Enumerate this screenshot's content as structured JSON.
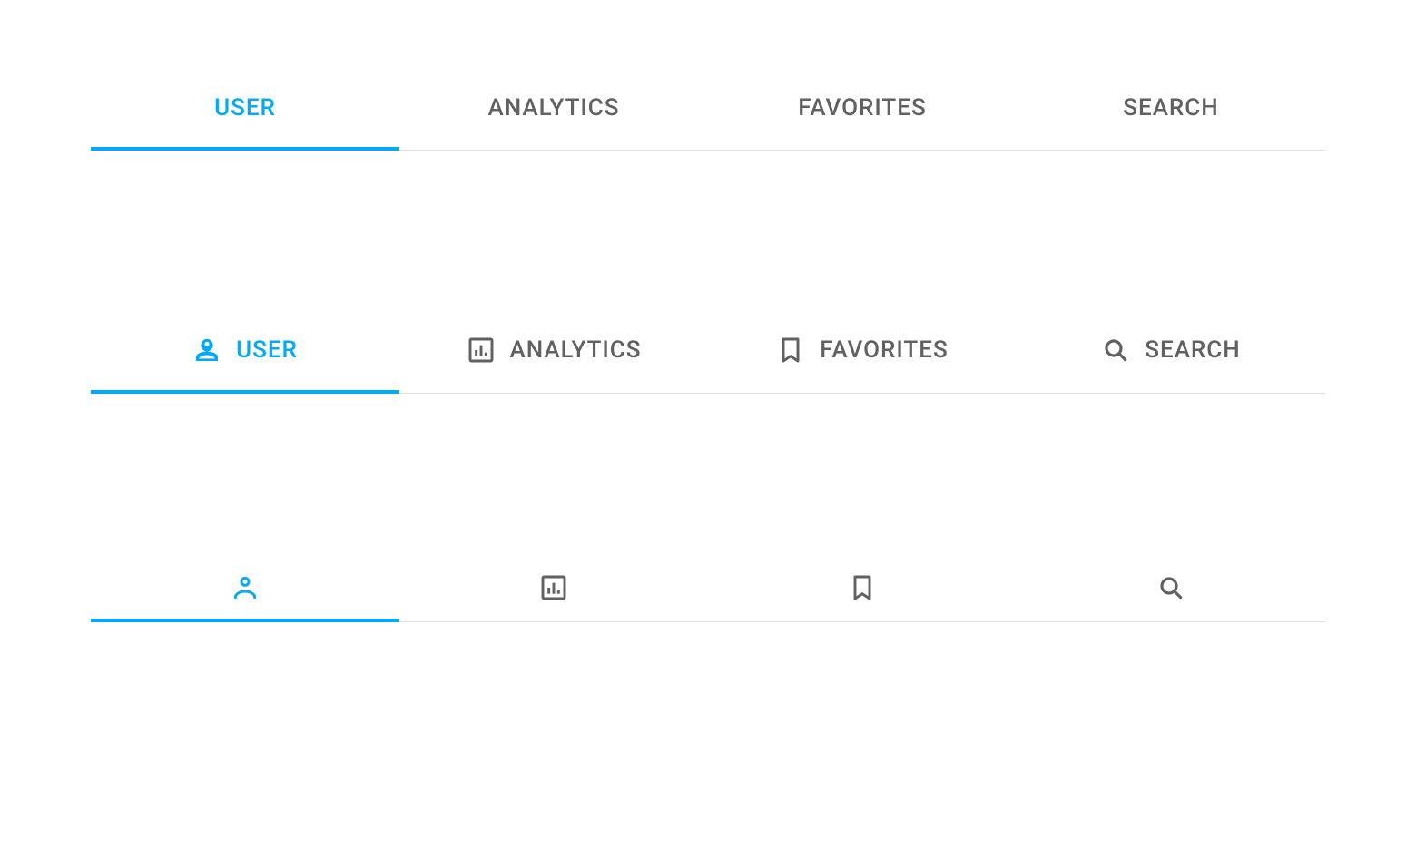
{
  "tabs": {
    "items": [
      {
        "label": "USER",
        "icon": "user-icon"
      },
      {
        "label": "ANALYTICS",
        "icon": "chart-icon"
      },
      {
        "label": "FAVORITES",
        "icon": "bookmark-icon"
      },
      {
        "label": "SEARCH",
        "icon": "search-icon"
      }
    ],
    "active_index": 0
  },
  "colors": {
    "active": "#03a9f4",
    "inactive": "#616161"
  }
}
